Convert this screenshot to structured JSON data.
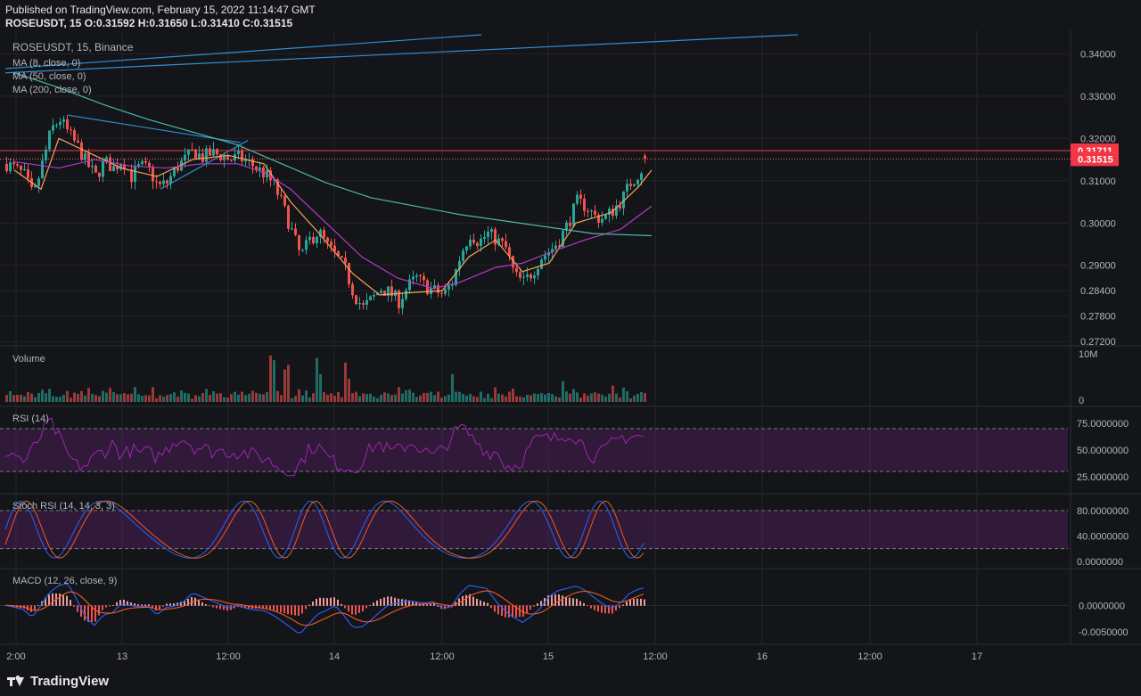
{
  "header": {
    "published_line": "Published on TradingView.com, February 15, 2022 11:14:47 GMT",
    "ohlc_line": "ROSEUSDT, 15  O:0.31592  H:0.31650  L:0.31410  C:0.31515"
  },
  "footer": {
    "brand": "TradingView"
  },
  "colors": {
    "background": "#141518",
    "grid": "#23252b",
    "up": "#26a69a",
    "down": "#ef5350",
    "ma8": "#f7a35c",
    "ma50": "#b53ac9",
    "ma200": "#4db6ac",
    "trendline": "#2f8fd6",
    "price_label": "#f23645",
    "rsi": "#9c27b0",
    "stoch_k": "#2962ff",
    "stoch_d": "#f05a28",
    "macd": "#2962ff",
    "signal": "#f05a28"
  },
  "chart_data": [
    {
      "type": "candlestick",
      "title": "ROSEUSDT, 15, Binance",
      "interval": "15",
      "exchange": "Binance",
      "ohlc_last": {
        "open": 0.31592,
        "high": 0.3165,
        "low": 0.3141,
        "close": 0.31515
      },
      "x_tick_labels": [
        "2:00",
        "13",
        "12:00",
        "14",
        "12:00",
        "15",
        "12:00",
        "16",
        "12:00",
        "17"
      ],
      "y_tick_labels": [
        "0.34000",
        "0.33000",
        "0.32000",
        "0.31000",
        "0.30000",
        "0.29000",
        "0.28400",
        "0.27800",
        "0.27200"
      ],
      "ylim": [
        0.2712,
        0.3445
      ],
      "price_labels": [
        {
          "value": "0.31711",
          "kind": "horizontal-line"
        },
        {
          "value": "0.31515",
          "kind": "last-price"
        }
      ],
      "close_path": [
        [
          0,
          0.314
        ],
        [
          10,
          0.3128
        ],
        [
          20,
          0.3112
        ],
        [
          30,
          0.306
        ],
        [
          40,
          0.314
        ],
        [
          50,
          0.322
        ],
        [
          60,
          0.3245
        ],
        [
          70,
          0.321
        ],
        [
          80,
          0.318
        ],
        [
          90,
          0.314
        ],
        [
          100,
          0.311
        ],
        [
          110,
          0.3145
        ],
        [
          120,
          0.313
        ],
        [
          130,
          0.315
        ],
        [
          140,
          0.311
        ],
        [
          150,
          0.3135
        ],
        [
          160,
          0.3125
        ],
        [
          170,
          0.3085
        ],
        [
          180,
          0.3095
        ],
        [
          190,
          0.313
        ],
        [
          200,
          0.315
        ],
        [
          210,
          0.317
        ],
        [
          220,
          0.3155
        ],
        [
          230,
          0.3165
        ],
        [
          240,
          0.316
        ],
        [
          250,
          0.315
        ],
        [
          260,
          0.3155
        ],
        [
          270,
          0.3145
        ],
        [
          280,
          0.313
        ],
        [
          290,
          0.3115
        ],
        [
          300,
          0.309
        ],
        [
          310,
          0.304
        ],
        [
          320,
          0.298
        ],
        [
          330,
          0.292
        ],
        [
          340,
          0.296
        ],
        [
          350,
          0.298
        ],
        [
          360,
          0.2945
        ],
        [
          370,
          0.292
        ],
        [
          380,
          0.289
        ],
        [
          390,
          0.283
        ],
        [
          400,
          0.28
        ],
        [
          410,
          0.282
        ],
        [
          420,
          0.2845
        ],
        [
          430,
          0.2835
        ],
        [
          440,
          0.2815
        ],
        [
          450,
          0.285
        ],
        [
          460,
          0.287
        ],
        [
          470,
          0.285
        ],
        [
          480,
          0.284
        ],
        [
          490,
          0.283
        ],
        [
          500,
          0.286
        ],
        [
          510,
          0.293
        ],
        [
          520,
          0.2975
        ],
        [
          530,
          0.2955
        ],
        [
          540,
          0.2975
        ],
        [
          550,
          0.296
        ],
        [
          560,
          0.294
        ],
        [
          570,
          0.2875
        ],
        [
          580,
          0.286
        ],
        [
          590,
          0.2885
        ],
        [
          600,
          0.292
        ],
        [
          610,
          0.2935
        ],
        [
          620,
          0.296
        ],
        [
          630,
          0.3
        ],
        [
          640,
          0.305
        ],
        [
          650,
          0.304
        ],
        [
          660,
          0.3015
        ],
        [
          670,
          0.301
        ],
        [
          680,
          0.303
        ],
        [
          690,
          0.3055
        ],
        [
          700,
          0.3095
        ],
        [
          710,
          0.312
        ],
        [
          720,
          0.3152
        ]
      ],
      "moving_averages": [
        {
          "name": "MA (8, close, 0)",
          "path": [
            [
              10,
              0.3125
            ],
            [
              40,
              0.308
            ],
            [
              60,
              0.32
            ],
            [
              90,
              0.317
            ],
            [
              130,
              0.313
            ],
            [
              170,
              0.311
            ],
            [
              210,
              0.315
            ],
            [
              250,
              0.316
            ],
            [
              290,
              0.314
            ],
            [
              320,
              0.305
            ],
            [
              350,
              0.298
            ],
            [
              390,
              0.288
            ],
            [
              420,
              0.283
            ],
            [
              450,
              0.2835
            ],
            [
              490,
              0.284
            ],
            [
              520,
              0.292
            ],
            [
              550,
              0.296
            ],
            [
              580,
              0.2885
            ],
            [
              610,
              0.2905
            ],
            [
              640,
              0.3
            ],
            [
              680,
              0.3025
            ],
            [
              710,
              0.3085
            ],
            [
              725,
              0.3125
            ]
          ]
        },
        {
          "name": "MA (50, close, 0)",
          "path": [
            [
              10,
              0.3145
            ],
            [
              60,
              0.313
            ],
            [
              100,
              0.315
            ],
            [
              140,
              0.3135
            ],
            [
              180,
              0.313
            ],
            [
              220,
              0.314
            ],
            [
              260,
              0.314
            ],
            [
              290,
              0.312
            ],
            [
              320,
              0.308
            ],
            [
              360,
              0.3
            ],
            [
              400,
              0.292
            ],
            [
              440,
              0.287
            ],
            [
              480,
              0.2845
            ],
            [
              510,
              0.286
            ],
            [
              550,
              0.2895
            ],
            [
              580,
              0.2905
            ],
            [
              610,
              0.293
            ],
            [
              650,
              0.296
            ],
            [
              690,
              0.2985
            ],
            [
              725,
              0.304
            ]
          ]
        },
        {
          "name": "MA (200, close, 0)",
          "path": [
            [
              10,
              0.3355
            ],
            [
              60,
              0.332
            ],
            [
              110,
              0.328
            ],
            [
              160,
              0.3245
            ],
            [
              210,
              0.3215
            ],
            [
              260,
              0.3185
            ],
            [
              310,
              0.314
            ],
            [
              360,
              0.3095
            ],
            [
              410,
              0.306
            ],
            [
              460,
              0.304
            ],
            [
              510,
              0.302
            ],
            [
              560,
              0.3005
            ],
            [
              610,
              0.299
            ],
            [
              660,
              0.2975
            ],
            [
              725,
              0.297
            ]
          ]
        }
      ]
    },
    {
      "type": "bar",
      "title": "Volume",
      "y_tick_labels": [
        "10M",
        "0"
      ]
    },
    {
      "type": "line",
      "title": "RSI (14)",
      "y_tick_labels": [
        "75.0000000",
        "50.0000000",
        "25.0000000"
      ],
      "bands": [
        30,
        70
      ]
    },
    {
      "type": "line",
      "title": "Stoch RSI (14, 14, 3, 3)",
      "y_tick_labels": [
        "80.0000000",
        "40.0000000",
        "0.0000000"
      ],
      "bands": [
        20,
        80
      ]
    },
    {
      "type": "line",
      "title": "MACD (12, 26, close, 9)",
      "y_tick_labels": [
        "0.0000000",
        "-0.0050000"
      ]
    }
  ]
}
